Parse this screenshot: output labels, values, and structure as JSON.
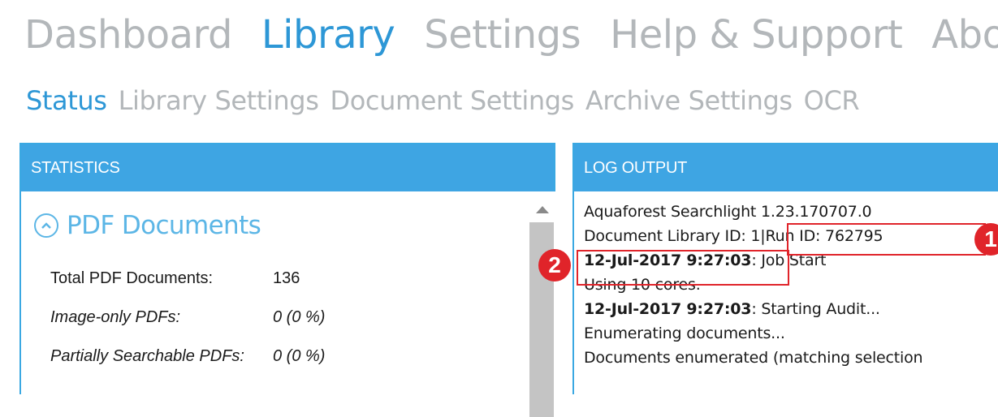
{
  "main_nav": [
    "Dashboard",
    "Library",
    "Settings",
    "Help & Support",
    "About"
  ],
  "sub_nav": [
    "Status",
    "Library Settings",
    "Document Settings",
    "Archive Settings",
    "OCR"
  ],
  "statistics": {
    "header": "STATISTICS",
    "section_title": "PDF Documents",
    "rows": [
      {
        "label": "Total PDF Documents:",
        "value": "136"
      },
      {
        "label": "Image-only PDFs:",
        "value": "0 (0 %)"
      },
      {
        "label": "Partially Searchable PDFs:",
        "value": "0 (0 %)"
      }
    ]
  },
  "log": {
    "header": "LOG OUTPUT",
    "line1": "Aquaforest Searchlight 1.23.170707.0",
    "line2a": "Document Library ID: 1|",
    "line2b": "Run ID: 762795",
    "line3a": "12-Jul-2017 9:27:03",
    "line3b": ": Job Start",
    "line4": "Using 10 cores.",
    "line5a": "12-Jul-2017 9:27:03",
    "line5b": ": Starting Audit...",
    "line6": "Enumerating documents...",
    "line7": "Documents enumerated (matching selection"
  },
  "annotations": [
    "1",
    "2"
  ],
  "colors": {
    "accent": "#2d97d6",
    "header": "#3ea5e3",
    "annotation": "#e0242a",
    "inactive": "#b3b7ba"
  }
}
